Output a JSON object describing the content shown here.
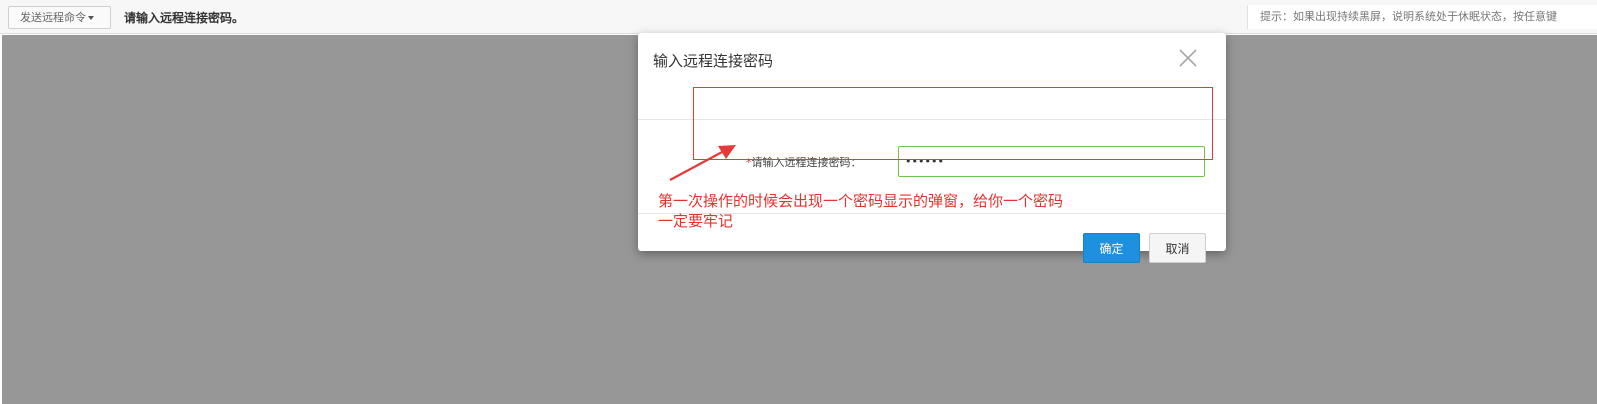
{
  "toolbar": {
    "send_command_label": "发送远程命令",
    "message": "请输入远程连接密码。",
    "hint": "提示：如果出现持续黑屏，说明系统处于休眠状态，按任意键"
  },
  "dialog": {
    "title": "输入远程连接密码",
    "field_required_mark": "*",
    "field_label": "请输入远程连接密码：",
    "password_value": "••••••",
    "ok_label": "确定",
    "cancel_label": "取消"
  },
  "annotation": {
    "line1": "第一次操作的时候会出现一个密码显示的弹窗，给你一个密码",
    "line2": "一定要牢记"
  },
  "colors": {
    "annotation_red": "#e5322d",
    "ok_blue": "#1e90e0",
    "input_focus_green": "#6fc24a",
    "remote_bg": "#979797"
  }
}
